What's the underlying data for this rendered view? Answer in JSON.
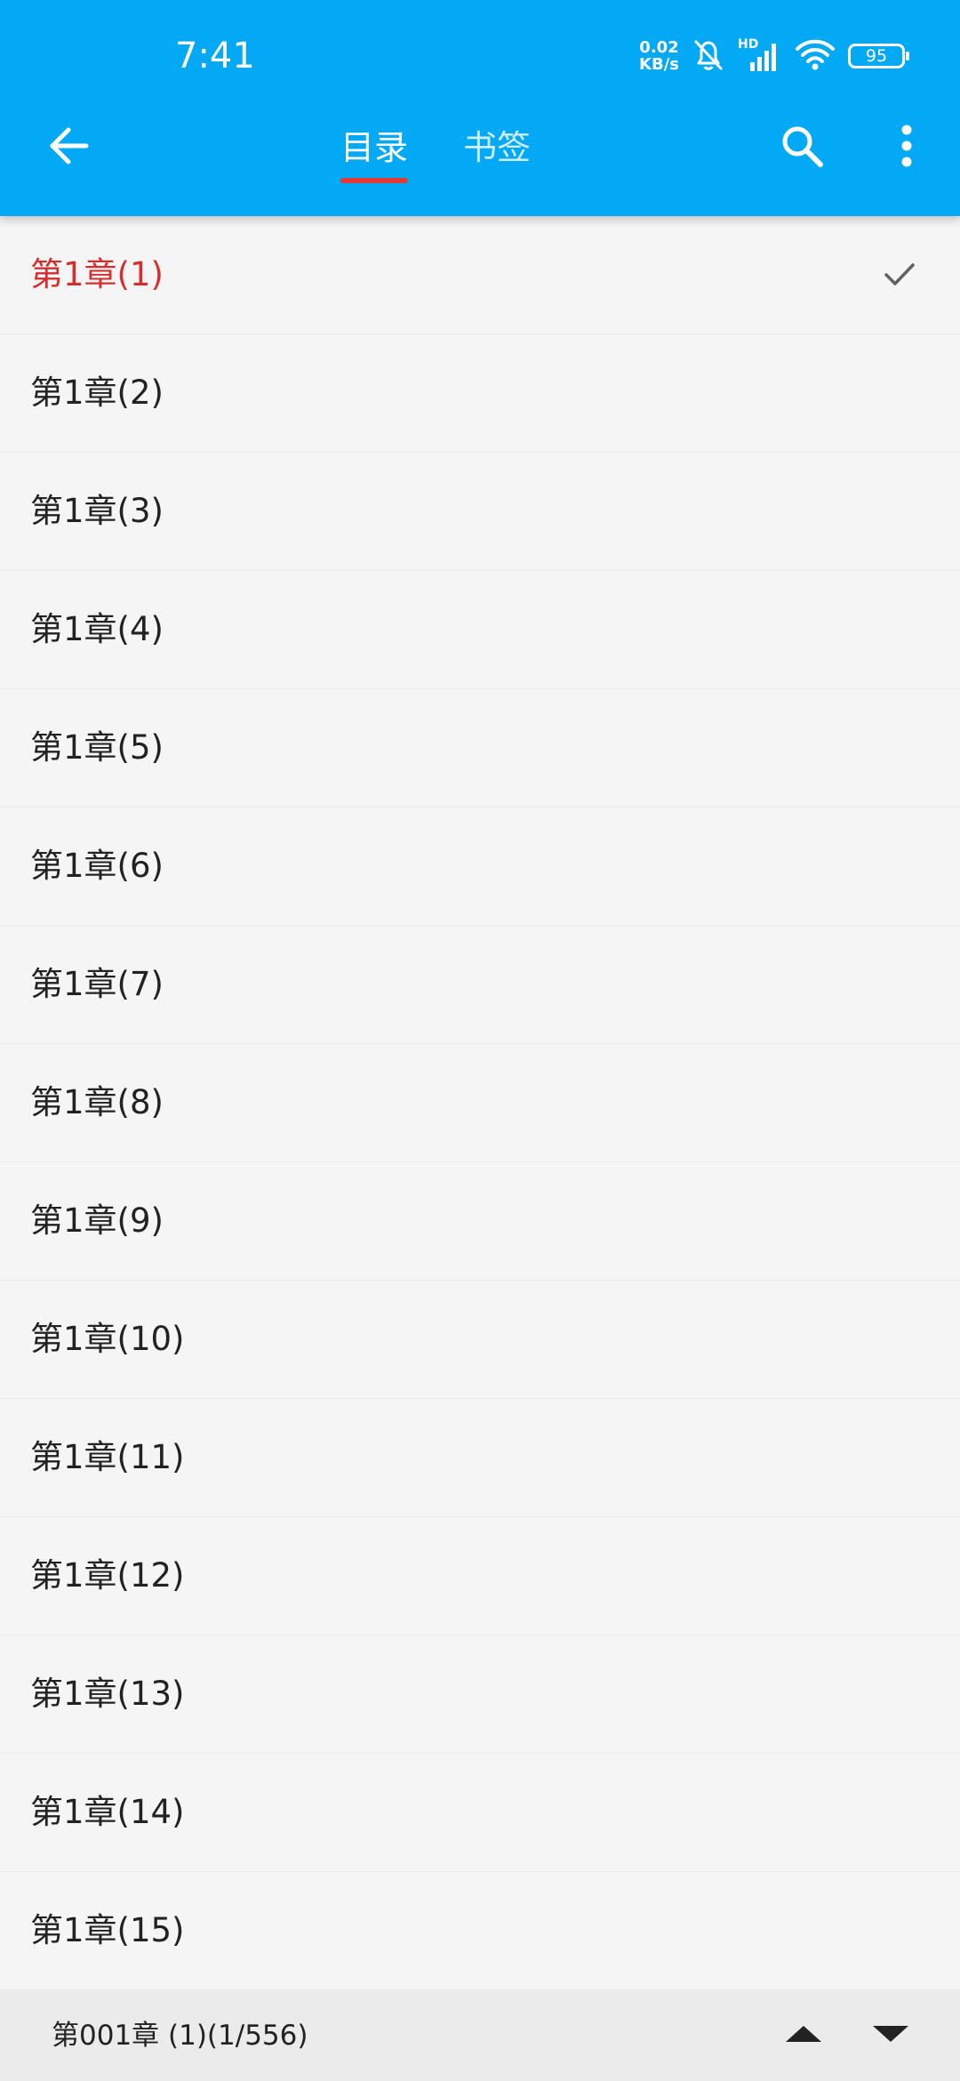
{
  "status_bar": {
    "time": "7:41",
    "net_speed_value": "0.02",
    "net_speed_unit": "KB/s",
    "signal_label": "HD",
    "battery_level": "95"
  },
  "toolbar": {
    "back_icon": "arrow-left-icon",
    "search_icon": "search-icon",
    "more_icon": "more-vertical-icon",
    "tabs": [
      {
        "label": "目录",
        "active": true
      },
      {
        "label": "书签",
        "active": false
      }
    ]
  },
  "chapters": [
    {
      "title": "第1章(1)",
      "current": true
    },
    {
      "title": "第1章(2)",
      "current": false
    },
    {
      "title": "第1章(3)",
      "current": false
    },
    {
      "title": "第1章(4)",
      "current": false
    },
    {
      "title": "第1章(5)",
      "current": false
    },
    {
      "title": "第1章(6)",
      "current": false
    },
    {
      "title": "第1章(7)",
      "current": false
    },
    {
      "title": "第1章(8)",
      "current": false
    },
    {
      "title": "第1章(9)",
      "current": false
    },
    {
      "title": "第1章(10)",
      "current": false
    },
    {
      "title": "第1章(11)",
      "current": false
    },
    {
      "title": "第1章(12)",
      "current": false
    },
    {
      "title": "第1章(13)",
      "current": false
    },
    {
      "title": "第1章(14)",
      "current": false
    },
    {
      "title": "第1章(15)",
      "current": false
    }
  ],
  "bottom_bar": {
    "position_label": "第001章 (1)(1/556)",
    "up_icon": "triangle-up-icon",
    "down_icon": "triangle-down-icon"
  },
  "colors": {
    "appbar": "#03a9f4",
    "accent_red": "#d32f2f",
    "background": "#f5f5f5"
  }
}
